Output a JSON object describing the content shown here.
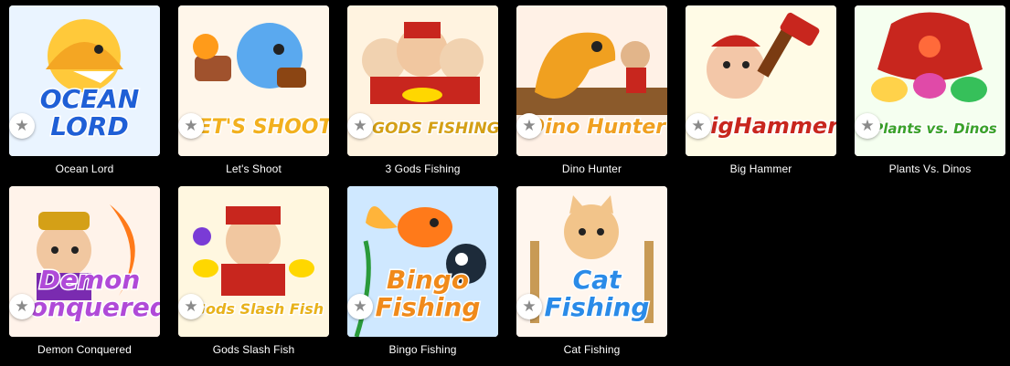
{
  "games": [
    {
      "title": "Ocean Lord",
      "logo": [
        "OCEAN",
        "LORD"
      ],
      "bg": "#eaf4ff",
      "accent": "#1f5fd6",
      "art": "shark",
      "fav_icon": "star-icon"
    },
    {
      "title": "Let's Shoot",
      "logo": [
        "LET'S SHOOT"
      ],
      "bg": "#fff6ea",
      "accent": "#f2b01e",
      "art": "shark-gun",
      "fav_icon": "star-icon"
    },
    {
      "title": "3 Gods Fishing",
      "logo": [
        "3 GODS FISHING"
      ],
      "bg": "#fff3e0",
      "accent": "#d4a017",
      "art": "gods",
      "fav_icon": "star-icon"
    },
    {
      "title": "Dino Hunter",
      "logo": [
        "Dino Hunter"
      ],
      "bg": "#fff1e6",
      "accent": "#f0a020",
      "art": "dino",
      "fav_icon": "star-icon"
    },
    {
      "title": "Big Hammer",
      "logo": [
        "BigHammer"
      ],
      "bg": "#fffbe6",
      "accent": "#c8261e",
      "art": "monkey",
      "fav_icon": "star-icon"
    },
    {
      "title": "Plants Vs. Dinos",
      "logo": [
        "Plants vs. Dinos"
      ],
      "bg": "#f5fff0",
      "accent": "#3aa12a",
      "art": "dragon",
      "fav_icon": "star-icon"
    },
    {
      "title": "Demon Conquered",
      "logo": [
        "Demon",
        "Conquered"
      ],
      "bg": "#fff3ea",
      "accent": "#b04ad8",
      "art": "warrior",
      "fav_icon": "star-icon"
    },
    {
      "title": "Gods Slash Fish",
      "logo": [
        "Gods Slash Fish"
      ],
      "bg": "#fff7e0",
      "accent": "#e8b21c",
      "art": "god",
      "fav_icon": "star-icon"
    },
    {
      "title": "Bingo Fishing",
      "logo": [
        "Bingo",
        "Fishing"
      ],
      "bg": "#eef8ff",
      "accent": "#f08a1a",
      "art": "goldfish",
      "fav_icon": "star-icon"
    },
    {
      "title": "Cat Fishing",
      "logo": [
        "Cat",
        "Fishing"
      ],
      "bg": "#fff6ee",
      "accent": "#2a8be8",
      "art": "cat",
      "fav_icon": "star-icon"
    }
  ]
}
